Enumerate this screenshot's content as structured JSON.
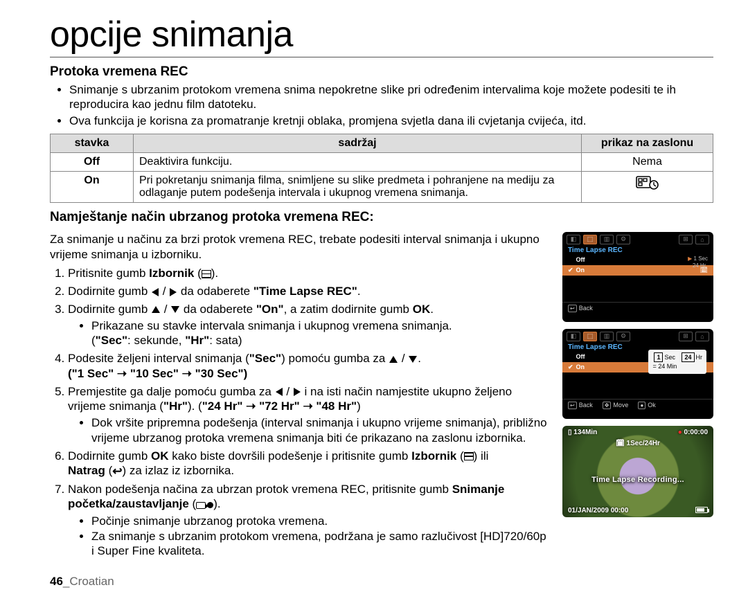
{
  "title": "opcije snimanja",
  "section1": {
    "heading": "Protoka vremena REC",
    "bullets": [
      "Snimanje s ubrzanim protokom vremena snima nepokretne slike pri određenim intervalima koje možete podesiti te ih reproducira kao jednu film datoteku.",
      "Ova funkcija je korisna za promatranje kretnji oblaka, promjena svjetla dana ili cvjetanja cvijeća, itd."
    ]
  },
  "table": {
    "head": {
      "c1": "stavka",
      "c2": "sadržaj",
      "c3": "prikaz na zaslonu"
    },
    "rows": [
      {
        "c1": "Off",
        "c2": "Deaktivira funkciju.",
        "c3": "Nema",
        "icon": null
      },
      {
        "c1": "On",
        "c2": "Pri pokretanju snimanja filma, snimljene su slike predmeta i pohranjene na mediju za odlaganje putem podešenja intervala i ukupnog vremena snimanja.",
        "c3": "",
        "icon": "time-lapse"
      }
    ]
  },
  "section2": {
    "heading": "Namještanje način ubrzanog protoka vremena REC:",
    "intro": "Za snimanje u načinu za brzi protok vremena REC, trebate podesiti interval snimanja i ukupno vrijeme snimanja u izborniku.",
    "steps": {
      "s1a": "Pritisnite gumb ",
      "s1b": "Izbornik",
      "s1c": " (",
      "s1d": ").",
      "s2a": "Dodirnite gumb ",
      "s2b": " / ",
      "s2c": " da odaberete ",
      "s2d": "\"Time Lapse REC\"",
      "s2e": ".",
      "s3a": "Dodirnite gumb ",
      "s3b": " / ",
      "s3c": " da odaberete ",
      "s3d": "\"On\"",
      "s3e": ",  a zatim dodirnite gumb ",
      "s3f": "OK",
      "s3g": ".",
      "s3sub1": "Prikazane su stavke intervala snimanja i ukupnog vremena snimanja.",
      "s3sub2": "(\"Sec\": sekunde, \"Hr\": sata)",
      "s4a": "Podesite željeni interval snimanja (",
      "s4b": "\"Sec\"",
      "s4c": ") pomoću gumba za ",
      "s4d": " / ",
      "s4e": ".",
      "s4line2": "(\"1 Sec\" ➝ \"10 Sec\" ➝ \"30 Sec\")",
      "s5a": "Premjestite ga dalje pomoću gumba za ",
      "s5b": " / ",
      "s5c": " i na isti način namjestite ukupno željeno vrijeme snimanja (",
      "s5d": "\"Hr\"",
      "s5e": "). (",
      "s5f": "\"24 Hr\" ➝ \"72 Hr\" ➝ \"48 Hr\"",
      "s5g": ")",
      "s5sub": "Dok vršite pripremna podešenja (interval snimanja i ukupno vrijeme snimanja), približno vrijeme ubrzanog protoka vremena snimanja biti će prikazano na zaslonu izbornika.",
      "s6a": "Dodirnite gumb ",
      "s6b": "OK",
      "s6c": " kako biste dovršili podešenje i pritisnite gumb ",
      "s6d": "Izbornik",
      "s6e": " (",
      "s6f": ") ili ",
      "s6g": "Natrag",
      "s6h": " (",
      "s6i": ") za izlaz iz izbornika.",
      "s7a": "Nakon podešenja načina za ubrzan protok vremena REC, pritisnite gumb ",
      "s7b": "Snimanje početka/zaustavljanje",
      "s7c": " (",
      "s7d": ").",
      "s7sub1": "Počinje snimanje ubrzanog protoka vremena.",
      "s7sub2": "Za snimanje s ubrzanim protokom vremena, podržana je samo razlučivost [HD]720/60p i Super Fine kvaliteta."
    }
  },
  "osd1": {
    "title": "Time Lapse REC",
    "off": "Off",
    "on": "On",
    "side1": "1 Sec",
    "side2": "24 Hr",
    "back": "Back"
  },
  "osd2": {
    "title": "Time Lapse REC",
    "off": "Off",
    "on": "On",
    "p_sec": "Sec",
    "p_hr": "Hr",
    "p_val1": "1",
    "p_val24": "24",
    "p_eq": "= 24 Min",
    "back": "Back",
    "move": "Move",
    "ok": "Ok"
  },
  "osd3": {
    "remain": "134Min",
    "timer": "0:00:00",
    "rate": "1Sec/24Hr",
    "mid": "Time Lapse Recording...",
    "date": "01/JAN/2009 00:00"
  },
  "footer": {
    "page": "46",
    "sep": "_",
    "lang": "Croatian"
  }
}
